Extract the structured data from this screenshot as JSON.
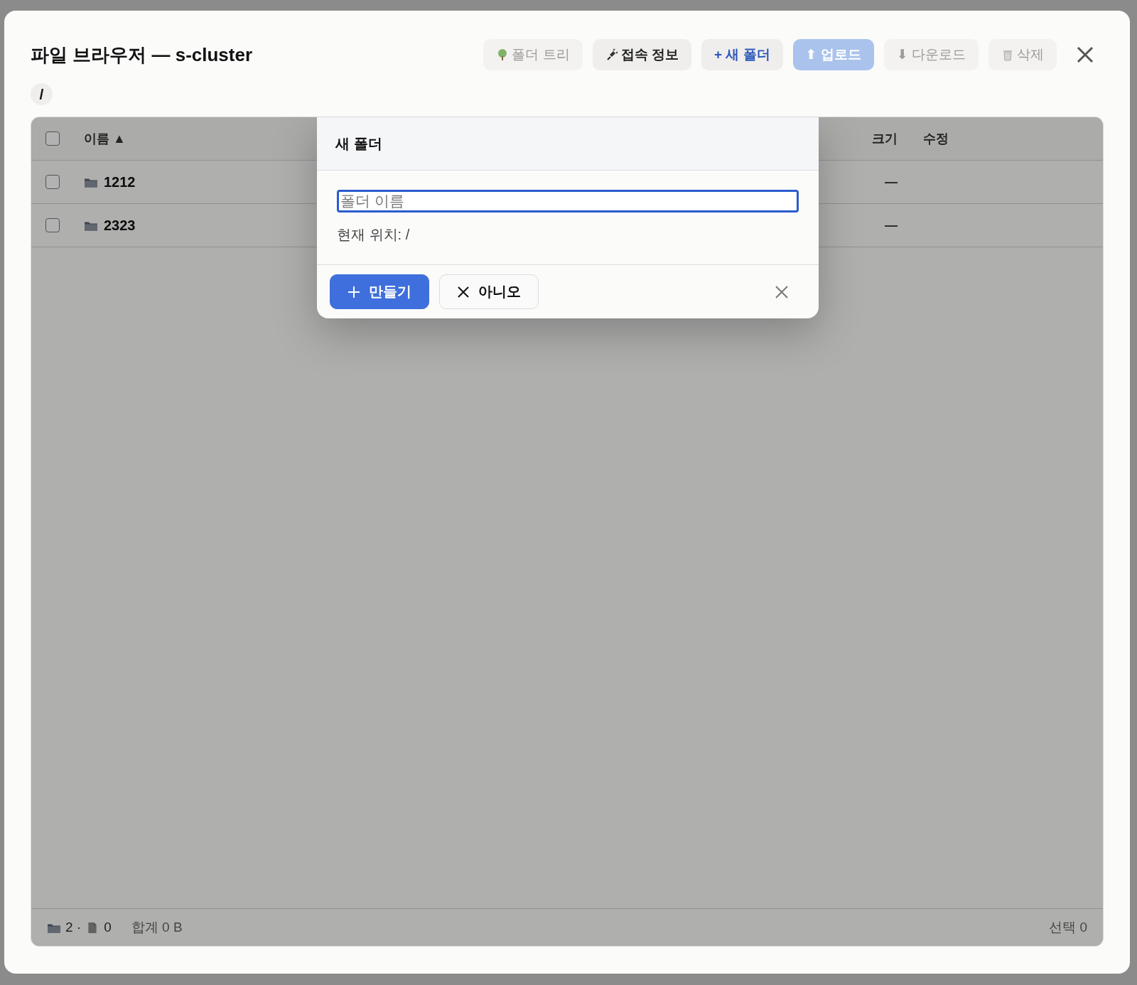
{
  "window": {
    "title": "파일 브라우저 — s-cluster"
  },
  "toolbar": [
    {
      "label": "폴더 트리",
      "kind": "plain",
      "disabled": true
    },
    {
      "label": "접속 정보",
      "kind": "plain",
      "disabled": false
    },
    {
      "label": "+ 새 폴더",
      "kind": "accent",
      "disabled": false
    },
    {
      "label": "⬆ 업로드",
      "kind": "primary",
      "disabled": true
    },
    {
      "label": "⬇ 다운로드",
      "kind": "plain",
      "disabled": true
    },
    {
      "label": "삭제",
      "kind": "plain",
      "disabled": true
    }
  ],
  "breadcrumb": "/",
  "table": {
    "select_all": {
      "checked": false
    },
    "columns": [
      {
        "label": "이름 ▲"
      },
      {
        "label": "크기"
      },
      {
        "label": "수정"
      }
    ],
    "rows": [
      {
        "name": "1212",
        "checked": false,
        "size": "—"
      },
      {
        "name": "2323",
        "checked": false,
        "size": "—"
      }
    ]
  },
  "status_bar": {
    "folders": "2 ·",
    "files": "0",
    "total": "합계 0 B",
    "selected": "선택 0"
  },
  "dialog": {
    "title": "새 폴더",
    "placeholder": "폴더 이름",
    "location": "현재 위치: /",
    "buttons": [
      {
        "label": "만들기",
        "kind": "primary"
      },
      {
        "label": "아니오",
        "kind": "secondary"
      }
    ]
  }
}
